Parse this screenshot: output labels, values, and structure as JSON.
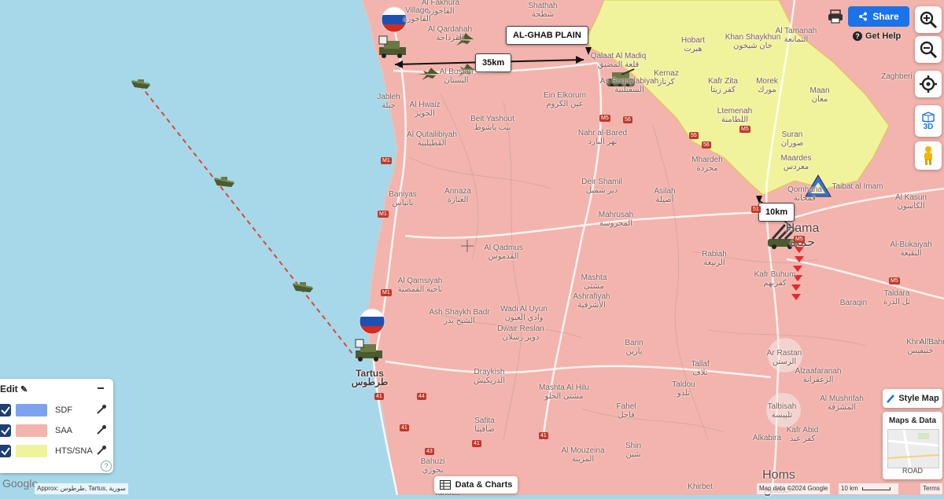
{
  "map": {
    "colors": {
      "sea": "#a6d8ea",
      "saa": "#f2b4ad",
      "hts_sna": "#f1f39c",
      "sdf": "#7ea2ef",
      "frontline_dashed": "#e0472f"
    },
    "places": [
      {
        "name": "Al Fakhura",
        "ar": "الفاخورة"
      },
      {
        "name": "Village",
        "ar": "الفاخورة"
      },
      {
        "name": "Shathah",
        "ar": "شطحة"
      },
      {
        "name": "Al Qardahah",
        "ar": "القرداحة"
      },
      {
        "name": "Jableh",
        "ar": "جبلة"
      },
      {
        "name": "Al Bustan",
        "ar": "البستان"
      },
      {
        "name": "Qalaat Al Madiq",
        "ar": "قلعة المضيق"
      },
      {
        "name": "As Suqaylabiyah",
        "ar": "السقيلبية"
      },
      {
        "name": "Hobart",
        "ar": "هبرت"
      },
      {
        "name": "Khan Shaykhun",
        "ar": "خان شيخون"
      },
      {
        "name": "Al Tamanah",
        "ar": "التمانعة"
      },
      {
        "name": "Kernaz",
        "ar": "كرناز"
      },
      {
        "name": "Kafr Zita",
        "ar": "كفر زيتا"
      },
      {
        "name": "Morek",
        "ar": "مورك"
      },
      {
        "name": "Maan",
        "ar": "معان"
      },
      {
        "name": "Zaghberi",
        "ar": ""
      },
      {
        "name": "Al Hwaiz",
        "ar": "الحويز"
      },
      {
        "name": "Ein Elkorum",
        "ar": "عين الكروم"
      },
      {
        "name": "Ltemenah",
        "ar": "اللطامنة"
      },
      {
        "name": "Beit Yashout",
        "ar": "بيت ياشوط"
      },
      {
        "name": "Nahr al-Bared",
        "ar": "نهر البارد"
      },
      {
        "name": "Al Qutailibiyah",
        "ar": "القطيلبية"
      },
      {
        "name": "Suran",
        "ar": "صوران"
      },
      {
        "name": "Mhardeh",
        "ar": "محردة"
      },
      {
        "name": "Maardes",
        "ar": "معردس"
      },
      {
        "name": "Qomhana",
        "ar": "قمحانة"
      },
      {
        "name": "Taibat al Imam",
        "ar": ""
      },
      {
        "name": "Al Kasun",
        "ar": "الكاسون"
      },
      {
        "name": "Al-Bukaiyah",
        "ar": "البقيعة"
      },
      {
        "name": "Baniyas",
        "ar": "بانياس"
      },
      {
        "name": "Annaza",
        "ar": "العنازة"
      },
      {
        "name": "Deir Shamil",
        "ar": "دير شميل"
      },
      {
        "name": "Asilah",
        "ar": "أصيلة"
      },
      {
        "name": "Hama",
        "ar": "حماة"
      },
      {
        "name": "Mahrusah",
        "ar": "المحروسة"
      },
      {
        "name": "Al Qadmus",
        "ar": "القدموس"
      },
      {
        "name": "Rabiah",
        "ar": "الربيعة"
      },
      {
        "name": "Kafr Buhum",
        "ar": "كفربهم"
      },
      {
        "name": "Al Qamsiyah",
        "ar": "ناحية القمصية"
      },
      {
        "name": "Mashta",
        "ar": "مشتى"
      },
      {
        "name": "Ashrafiyah",
        "ar": "الأشرفية"
      },
      {
        "name": "Baraqin",
        "ar": ""
      },
      {
        "name": "Taldara",
        "ar": "تل الدرة"
      },
      {
        "name": "Wadi Al Uyun",
        "ar": "وادي العيون"
      },
      {
        "name": "Ash Shaykh Badr",
        "ar": "الشيخ بدر"
      },
      {
        "name": "Dwair Reslan",
        "ar": "دوير رسلان"
      },
      {
        "name": "Barin",
        "ar": "بارين"
      },
      {
        "name": "Ar Rastan",
        "ar": "الرستن"
      },
      {
        "name": "Khneifis",
        "ar": "خنيفيس"
      },
      {
        "name": "Tartus",
        "ar": "طرطوس"
      },
      {
        "name": "Draykish",
        "ar": "الدريكيش"
      },
      {
        "name": "Mashta Al Hilu",
        "ar": "مشتى الحلو"
      },
      {
        "name": "Tallaf",
        "ar": "تلاف"
      },
      {
        "name": "Taldou",
        "ar": "تلدو"
      },
      {
        "name": "Alzaafaranah",
        "ar": "الزعفرانة"
      },
      {
        "name": "Al Mushrifah",
        "ar": "المشرفة"
      },
      {
        "name": "Talbisah",
        "ar": "تلبيسة"
      },
      {
        "name": "Fahel",
        "ar": "فاحل"
      },
      {
        "name": "Safita",
        "ar": "صافيتا"
      },
      {
        "name": "Al Mouzeina",
        "ar": "المزينة"
      },
      {
        "name": "Shin",
        "ar": "شين"
      },
      {
        "name": "Bahuzi",
        "ar": "بحوزي"
      },
      {
        "name": "Khirbet",
        "ar": ""
      },
      {
        "name": "Kafr Abid",
        "ar": "كفر عبد"
      },
      {
        "name": "Al Bahr",
        "ar": ""
      },
      {
        "name": "Homs",
        "ar": "حمص"
      },
      {
        "name": "Tartous",
        "ar": ""
      },
      {
        "name": "Alkabira",
        "ar": ""
      }
    ],
    "callouts": {
      "plain": "AL-GHAB PLAIN",
      "dist_a": "35km",
      "dist_b": "10km"
    },
    "road_labels": [
      "M1",
      "M1",
      "M1",
      "M5",
      "M5",
      "M5",
      "41",
      "41",
      "41",
      "44",
      "51",
      "55",
      "56",
      "56",
      "43",
      "41",
      "M5"
    ]
  },
  "controls": {
    "share": "Share",
    "get_help": "Get Help",
    "three_d": "3D",
    "style_map": "Style Map",
    "maps_and_data": "Maps & Data",
    "road": "ROAD",
    "data_charts": "Data & Charts"
  },
  "legend": {
    "title": "Edit",
    "items": [
      {
        "label": "SDF",
        "color": "#7ea2ef"
      },
      {
        "label": "SAA",
        "color": "#f2b4ad"
      },
      {
        "label": "HTS/SNA",
        "color": "#f1f39c"
      }
    ]
  },
  "attribution": {
    "google": "Google",
    "approx": "Approx: طرطوس, Tartus, سورية",
    "mapdata": "Map data ©2024 Google",
    "scale": "10 km",
    "terms": "Terms"
  }
}
